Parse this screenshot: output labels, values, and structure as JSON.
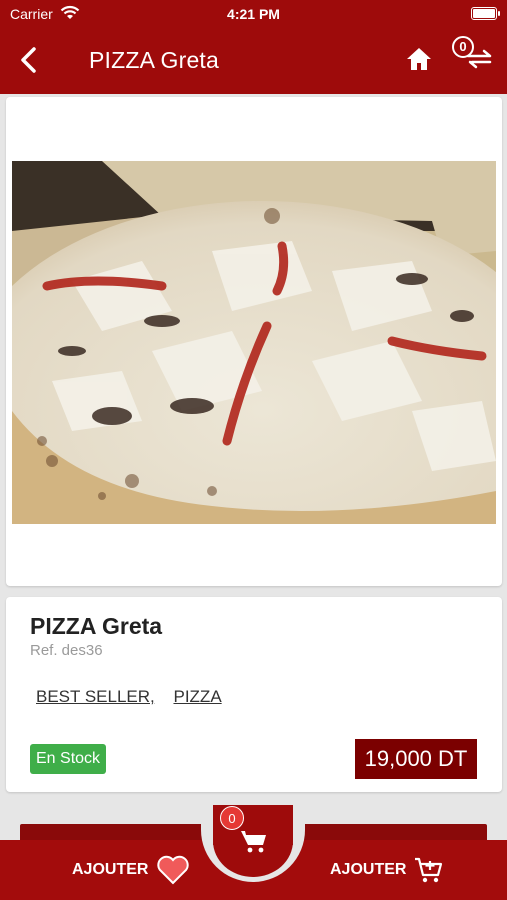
{
  "status_bar": {
    "carrier": "Carrier",
    "time": "4:21 PM"
  },
  "nav": {
    "title": "PIZZA Greta",
    "compare_count": "0"
  },
  "product": {
    "name": "PIZZA Greta",
    "ref": "Ref. des36",
    "categories": [
      "BEST SELLER,",
      "PIZZA"
    ],
    "stock": "En Stock",
    "price": "19,000 DT"
  },
  "bottom_bar": {
    "wishlist_label": "AJOUTER",
    "add_to_cart_label": "AJOUTER",
    "cart_count": "0"
  },
  "colors": {
    "brand": "#9e0b0b",
    "stock": "#3fae49",
    "price_bg": "#7b0000"
  },
  "icons": [
    "back-icon",
    "home-icon",
    "compare-icon",
    "heart-icon",
    "cart-icon",
    "add-cart-icon"
  ]
}
